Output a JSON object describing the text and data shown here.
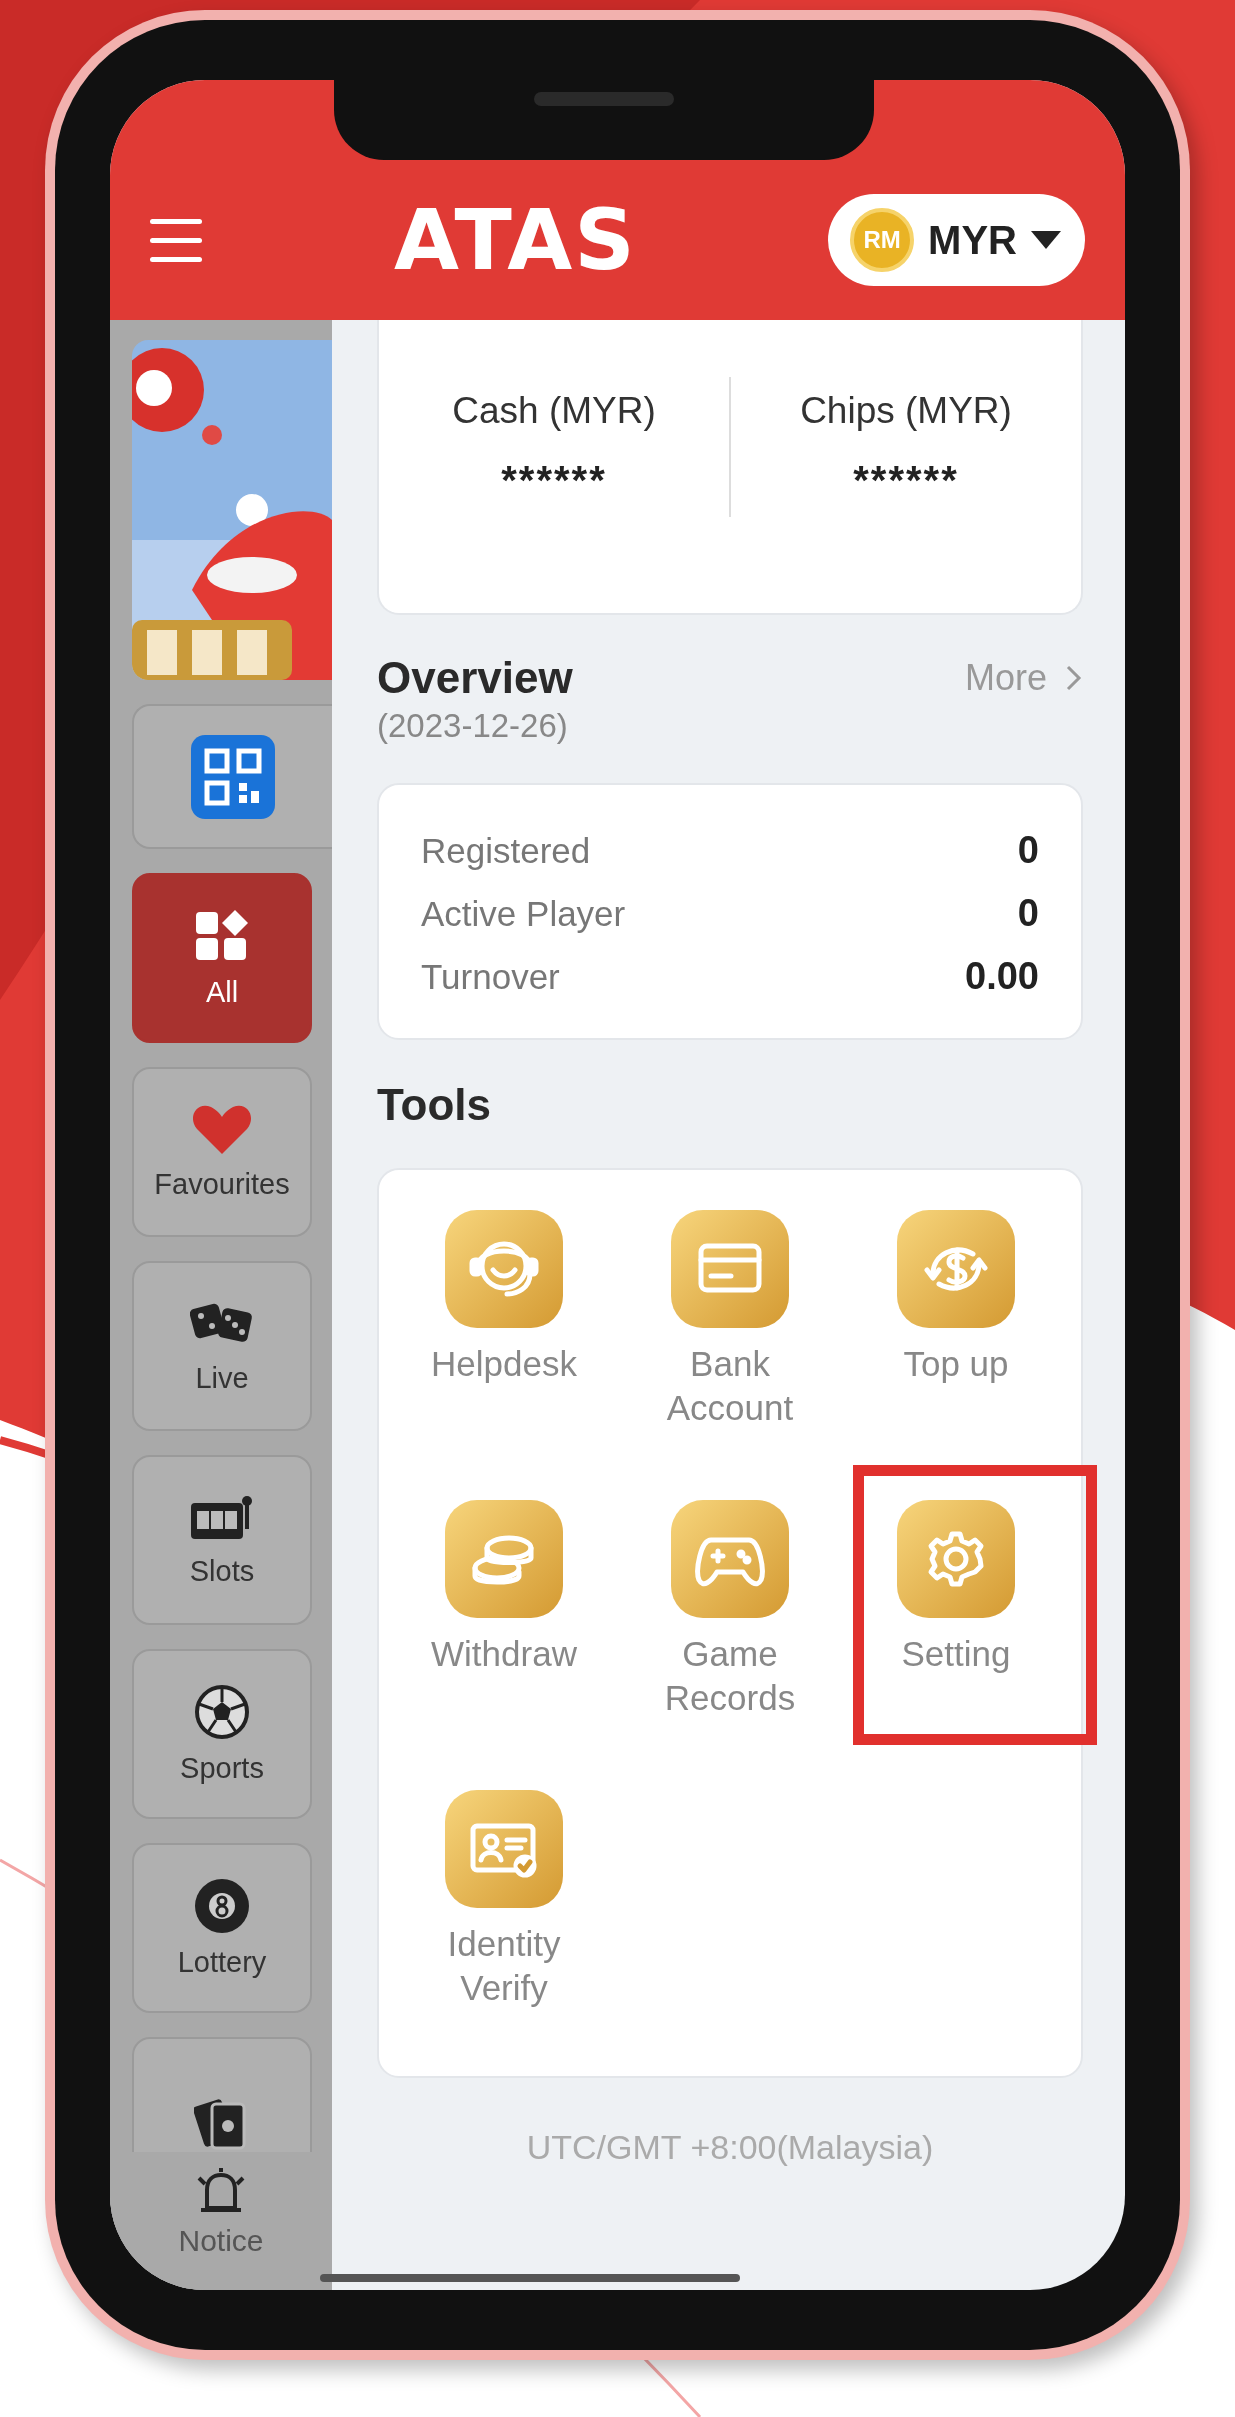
{
  "header": {
    "logo": "ATAS",
    "currency": {
      "badge": "RM",
      "code": "MYR"
    }
  },
  "sidebar": {
    "items": [
      {
        "kind": "banner"
      },
      {
        "kind": "qr",
        "selected": false
      },
      {
        "kind": "grid",
        "label": "All",
        "selected": true
      },
      {
        "kind": "heart",
        "label": "Favourites",
        "selected": false
      },
      {
        "kind": "dice",
        "label": "Live",
        "selected": false
      },
      {
        "kind": "slots",
        "label": "Slots",
        "selected": false
      },
      {
        "kind": "ball",
        "label": "Sports",
        "selected": false
      },
      {
        "kind": "eight",
        "label": "Lottery",
        "selected": false
      },
      {
        "kind": "cards",
        "selected": false
      }
    ],
    "notice": "Notice"
  },
  "balances": [
    {
      "label": "Cash (MYR)",
      "value": "******"
    },
    {
      "label": "Chips (MYR)",
      "value": "******"
    }
  ],
  "overview": {
    "title": "Overview",
    "date": "(2023-12-26)",
    "more": "More",
    "stats": [
      {
        "label": "Registered",
        "value": "0"
      },
      {
        "label": "Active Player",
        "value": "0"
      },
      {
        "label": "Turnover",
        "value": "0.00"
      }
    ]
  },
  "tools": {
    "title": "Tools",
    "items": [
      {
        "label": "Helpdesk",
        "kind": "headset",
        "highlighted": false
      },
      {
        "label": "Bank Account",
        "kind": "card",
        "highlighted": false
      },
      {
        "label": "Top up",
        "kind": "topup",
        "highlighted": false
      },
      {
        "label": "Withdraw",
        "kind": "coins",
        "highlighted": false
      },
      {
        "label": "Game Records",
        "kind": "gamepad",
        "highlighted": false
      },
      {
        "label": "Setting",
        "kind": "gear",
        "highlighted": true
      },
      {
        "label": "Identity Verify",
        "kind": "idcard",
        "highlighted": false
      }
    ]
  },
  "footer": "UTC/GMT +8:00(Malaysia)"
}
